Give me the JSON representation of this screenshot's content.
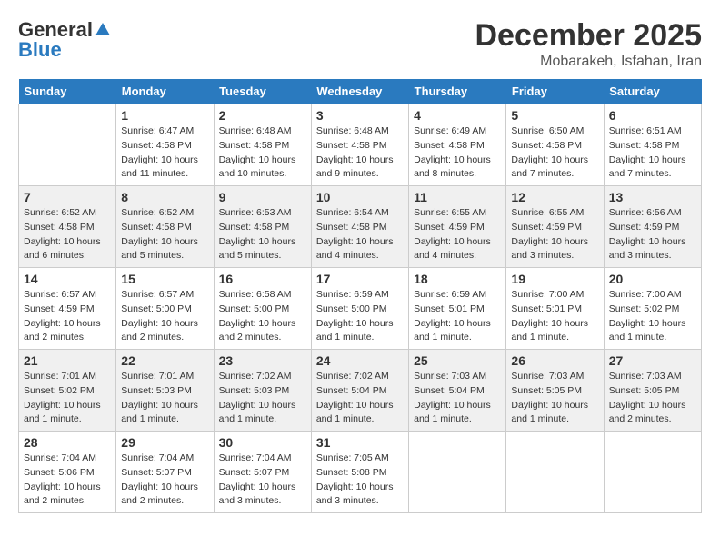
{
  "logo": {
    "general": "General",
    "blue": "Blue"
  },
  "title": "December 2025",
  "subtitle": "Mobarakeh, Isfahan, Iran",
  "days_of_week": [
    "Sunday",
    "Monday",
    "Tuesday",
    "Wednesday",
    "Thursday",
    "Friday",
    "Saturday"
  ],
  "weeks": [
    [
      {
        "day": "",
        "info": ""
      },
      {
        "day": "1",
        "info": "Sunrise: 6:47 AM\nSunset: 4:58 PM\nDaylight: 10 hours\nand 11 minutes."
      },
      {
        "day": "2",
        "info": "Sunrise: 6:48 AM\nSunset: 4:58 PM\nDaylight: 10 hours\nand 10 minutes."
      },
      {
        "day": "3",
        "info": "Sunrise: 6:48 AM\nSunset: 4:58 PM\nDaylight: 10 hours\nand 9 minutes."
      },
      {
        "day": "4",
        "info": "Sunrise: 6:49 AM\nSunset: 4:58 PM\nDaylight: 10 hours\nand 8 minutes."
      },
      {
        "day": "5",
        "info": "Sunrise: 6:50 AM\nSunset: 4:58 PM\nDaylight: 10 hours\nand 7 minutes."
      },
      {
        "day": "6",
        "info": "Sunrise: 6:51 AM\nSunset: 4:58 PM\nDaylight: 10 hours\nand 7 minutes."
      }
    ],
    [
      {
        "day": "7",
        "info": "Sunrise: 6:52 AM\nSunset: 4:58 PM\nDaylight: 10 hours\nand 6 minutes."
      },
      {
        "day": "8",
        "info": "Sunrise: 6:52 AM\nSunset: 4:58 PM\nDaylight: 10 hours\nand 5 minutes."
      },
      {
        "day": "9",
        "info": "Sunrise: 6:53 AM\nSunset: 4:58 PM\nDaylight: 10 hours\nand 5 minutes."
      },
      {
        "day": "10",
        "info": "Sunrise: 6:54 AM\nSunset: 4:58 PM\nDaylight: 10 hours\nand 4 minutes."
      },
      {
        "day": "11",
        "info": "Sunrise: 6:55 AM\nSunset: 4:59 PM\nDaylight: 10 hours\nand 4 minutes."
      },
      {
        "day": "12",
        "info": "Sunrise: 6:55 AM\nSunset: 4:59 PM\nDaylight: 10 hours\nand 3 minutes."
      },
      {
        "day": "13",
        "info": "Sunrise: 6:56 AM\nSunset: 4:59 PM\nDaylight: 10 hours\nand 3 minutes."
      }
    ],
    [
      {
        "day": "14",
        "info": "Sunrise: 6:57 AM\nSunset: 4:59 PM\nDaylight: 10 hours\nand 2 minutes."
      },
      {
        "day": "15",
        "info": "Sunrise: 6:57 AM\nSunset: 5:00 PM\nDaylight: 10 hours\nand 2 minutes."
      },
      {
        "day": "16",
        "info": "Sunrise: 6:58 AM\nSunset: 5:00 PM\nDaylight: 10 hours\nand 2 minutes."
      },
      {
        "day": "17",
        "info": "Sunrise: 6:59 AM\nSunset: 5:00 PM\nDaylight: 10 hours\nand 1 minute."
      },
      {
        "day": "18",
        "info": "Sunrise: 6:59 AM\nSunset: 5:01 PM\nDaylight: 10 hours\nand 1 minute."
      },
      {
        "day": "19",
        "info": "Sunrise: 7:00 AM\nSunset: 5:01 PM\nDaylight: 10 hours\nand 1 minute."
      },
      {
        "day": "20",
        "info": "Sunrise: 7:00 AM\nSunset: 5:02 PM\nDaylight: 10 hours\nand 1 minute."
      }
    ],
    [
      {
        "day": "21",
        "info": "Sunrise: 7:01 AM\nSunset: 5:02 PM\nDaylight: 10 hours\nand 1 minute."
      },
      {
        "day": "22",
        "info": "Sunrise: 7:01 AM\nSunset: 5:03 PM\nDaylight: 10 hours\nand 1 minute."
      },
      {
        "day": "23",
        "info": "Sunrise: 7:02 AM\nSunset: 5:03 PM\nDaylight: 10 hours\nand 1 minute."
      },
      {
        "day": "24",
        "info": "Sunrise: 7:02 AM\nSunset: 5:04 PM\nDaylight: 10 hours\nand 1 minute."
      },
      {
        "day": "25",
        "info": "Sunrise: 7:03 AM\nSunset: 5:04 PM\nDaylight: 10 hours\nand 1 minute."
      },
      {
        "day": "26",
        "info": "Sunrise: 7:03 AM\nSunset: 5:05 PM\nDaylight: 10 hours\nand 1 minute."
      },
      {
        "day": "27",
        "info": "Sunrise: 7:03 AM\nSunset: 5:05 PM\nDaylight: 10 hours\nand 2 minutes."
      }
    ],
    [
      {
        "day": "28",
        "info": "Sunrise: 7:04 AM\nSunset: 5:06 PM\nDaylight: 10 hours\nand 2 minutes."
      },
      {
        "day": "29",
        "info": "Sunrise: 7:04 AM\nSunset: 5:07 PM\nDaylight: 10 hours\nand 2 minutes."
      },
      {
        "day": "30",
        "info": "Sunrise: 7:04 AM\nSunset: 5:07 PM\nDaylight: 10 hours\nand 3 minutes."
      },
      {
        "day": "31",
        "info": "Sunrise: 7:05 AM\nSunset: 5:08 PM\nDaylight: 10 hours\nand 3 minutes."
      },
      {
        "day": "",
        "info": ""
      },
      {
        "day": "",
        "info": ""
      },
      {
        "day": "",
        "info": ""
      }
    ]
  ]
}
